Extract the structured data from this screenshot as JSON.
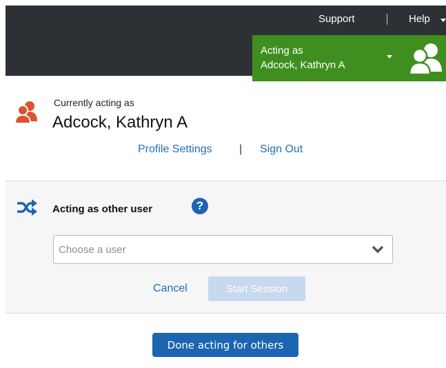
{
  "topbar": {
    "support_label": "Support",
    "help_label": "Help",
    "acting_line1": "Acting as",
    "acting_line2": "Adcock, Kathryn A"
  },
  "current": {
    "label": "Currently acting as",
    "name": "Adcock, Kathryn A",
    "profile_link": "Profile Settings",
    "separator": "|",
    "signout_link": "Sign Out"
  },
  "panel": {
    "heading": "Acting as other user",
    "help_glyph": "?",
    "select_placeholder": "Choose a user",
    "cancel_label": "Cancel",
    "start_label": "Start Session"
  },
  "done_label": "Done acting for others",
  "icons": {
    "avatar": "users-icon",
    "current_user": "users-icon",
    "shuffle": "shuffle-icon",
    "help": "question-circle-icon",
    "dropdown": "chevron-down-icon"
  },
  "colors": {
    "topbar": "#2d3136",
    "acting_green": "#3e8f1f",
    "link_blue": "#1f6fb8",
    "user_icon_orange": "#d9532e",
    "primary_button": "#1b65b1",
    "disabled_button": "#c7d9ee"
  }
}
